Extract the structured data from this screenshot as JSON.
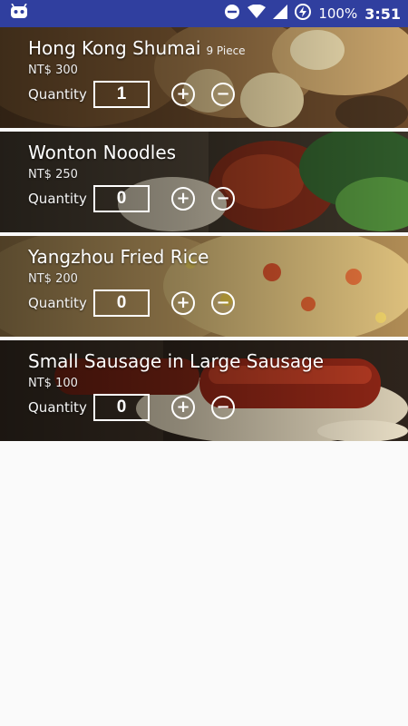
{
  "status_bar": {
    "battery": "100%",
    "time": "3:51",
    "icons": [
      "android-bot-icon",
      "do-not-disturb-icon",
      "wifi-icon",
      "cell-signal-icon",
      "battery-charging-icon"
    ]
  },
  "food_list": {
    "quantity_label": "Quantity",
    "items": [
      {
        "name": "Hong Kong Shumai",
        "unit": "9 Piece",
        "price": "NT$ 300",
        "quantity": "1"
      },
      {
        "name": "Wonton Noodles",
        "unit": "",
        "price": "NT$ 250",
        "quantity": "0"
      },
      {
        "name": "Yangzhou Fried Rice",
        "unit": "",
        "price": "NT$ 200",
        "quantity": "0"
      },
      {
        "name": "Small Sausage in Large Sausage",
        "unit": "",
        "price": "NT$ 100",
        "quantity": "0"
      }
    ],
    "buttons": {
      "increase_symbol": "+",
      "decrease_symbol": "−"
    }
  }
}
